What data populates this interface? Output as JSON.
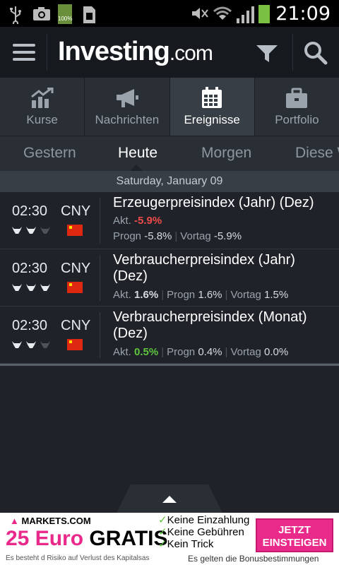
{
  "status_bar": {
    "time": "21:09",
    "battery_label": "100%"
  },
  "app_bar": {
    "logo_main": "Investing",
    "logo_suffix": ".com"
  },
  "tabs": [
    {
      "label": "Kurse",
      "icon": "chart-icon",
      "active": false
    },
    {
      "label": "Nachrichten",
      "icon": "megaphone-icon",
      "active": false
    },
    {
      "label": "Ereignisse",
      "icon": "calendar-icon",
      "active": true
    },
    {
      "label": "Portfolio",
      "icon": "briefcase-icon",
      "active": false
    }
  ],
  "days": [
    {
      "label": "Gestern",
      "active": false
    },
    {
      "label": "Heute",
      "active": true
    },
    {
      "label": "Morgen",
      "active": false
    },
    {
      "label": "Diese W",
      "active": false
    }
  ],
  "date_header": "Saturday, January 09",
  "events": [
    {
      "time": "02:30",
      "currency": "CNY",
      "importance": 2,
      "title": "Erzeugerpreisindex (Jahr) (Dez)",
      "actual_label": "Akt.",
      "actual": "-5.9%",
      "forecast_label": "Progn",
      "forecast": "-5.8%",
      "previous_label": "Vortag",
      "previous": "-5.9%"
    },
    {
      "time": "02:30",
      "currency": "CNY",
      "importance": 3,
      "title": "Verbraucherpreisindex (Jahr) (Dez)",
      "actual_label": "Akt.",
      "actual": "1.6%",
      "forecast_label": "Progn",
      "forecast": "1.6%",
      "previous_label": "Vortag",
      "previous": "1.5%"
    },
    {
      "time": "02:30",
      "currency": "CNY",
      "importance": 2,
      "title": "Verbraucherpreisindex (Monat) (Dez)",
      "actual_label": "Akt.",
      "actual": "0.5%",
      "forecast_label": "Progn",
      "forecast": "0.4%",
      "previous_label": "Vortag",
      "previous": "0.0%"
    }
  ],
  "ad": {
    "brand": "MARKETS.COM",
    "headline_num": "25 Euro",
    "headline_word": "GRATIS",
    "check1": "Keine Einzahlung",
    "check2": "Keine Gebühren",
    "check3": "Kein Trick",
    "cta_line1": "JETZT",
    "cta_line2": "EINSTEIGEN",
    "fine_left": "Es besteht d Risiko auf Verlust des Kapitalsas",
    "fine_right": "Es gelten die Bonusbestimmungen"
  },
  "colors": {
    "negative": "#ef4a4a",
    "positive": "#5ec53e",
    "accent_pink": "#ea2a8a"
  }
}
